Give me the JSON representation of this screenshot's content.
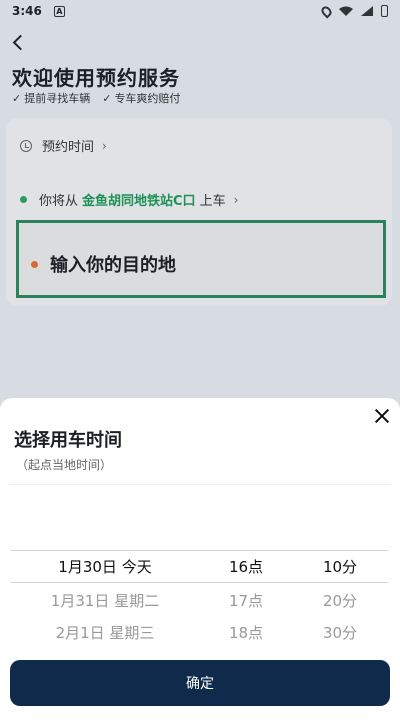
{
  "status_bar": {
    "time": "3:46",
    "indicator": "A"
  },
  "header": {
    "title": "欢迎使用预约服务",
    "features": [
      "提前寻找车辆",
      "专车爽约赔付"
    ]
  },
  "booking": {
    "time_label": "预约时间",
    "pickup_prefix": "你将从",
    "pickup_station": "金鱼胡同地铁站C口",
    "pickup_suffix": "上车",
    "destination_placeholder": "输入你的目的地"
  },
  "sheet": {
    "title": "选择用车时间",
    "subtitle": "（起点当地时间）",
    "picker": {
      "dates": [
        "1月30日 今天",
        "1月31日 星期二",
        "2月1日 星期三"
      ],
      "hours": [
        "16点",
        "17点",
        "18点"
      ],
      "minutes": [
        "10分",
        "20分",
        "30分"
      ]
    },
    "confirm_label": "确定"
  },
  "colors": {
    "accent_green": "#2aa466",
    "dest_dot": "#e56d3a",
    "confirm_bg": "#0f2a4a"
  }
}
